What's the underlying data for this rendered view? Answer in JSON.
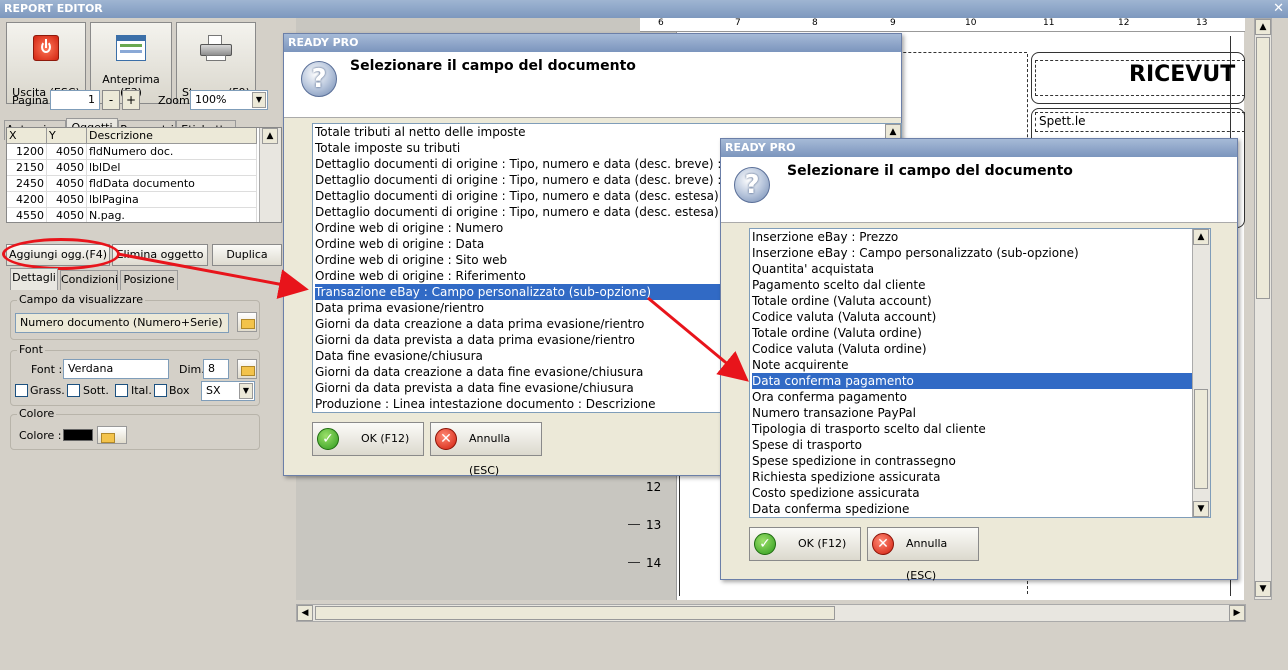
{
  "app": {
    "title": "REPORT EDITOR"
  },
  "toolbar": {
    "exit_label": "Uscita (ESC)",
    "preview_label": "Anteprima (F3)",
    "print_label": "Stampa (F9)",
    "page_label": "Pagina",
    "page_value": "1",
    "zoom_label": "Zoom",
    "zoom_value": "100%"
  },
  "tabs_top": [
    "Anteprima",
    "Oggetti",
    "Parametri",
    "Etichette"
  ],
  "objects_table": {
    "columns": [
      "X",
      "Y",
      "Descrizione"
    ],
    "rows": [
      {
        "x": "1200",
        "y": "4050",
        "desc": "fldNumero doc."
      },
      {
        "x": "2150",
        "y": "4050",
        "desc": "lblDel"
      },
      {
        "x": "2450",
        "y": "4050",
        "desc": "fldData documento"
      },
      {
        "x": "4200",
        "y": "4050",
        "desc": "lblPagina"
      },
      {
        "x": "4550",
        "y": "4050",
        "desc": "N.pag."
      }
    ]
  },
  "object_buttons": {
    "add": "Aggiungi ogg.(F4)",
    "delete": "Elimina oggetto",
    "duplicate": "Duplica"
  },
  "tabs_bottom": [
    "Dettagli",
    "Condizioni",
    "Posizione"
  ],
  "details": {
    "field_group_label": "Campo da visualizzare",
    "field_value": "Numero documento (Numero+Serie)",
    "font_group_label": "Font",
    "font_label": "Font :",
    "font_value": "Verdana",
    "dim_label": "Dim.",
    "dim_value": "8",
    "bold_label": "Grass.",
    "underline_label": "Sott.",
    "italic_label": "Ital.",
    "box_label": "Box",
    "align_value": "SX",
    "color_group_label": "Colore",
    "color_label": "Colore :",
    "color_value": "#000000"
  },
  "document_preview": {
    "ruler_marks": [
      "6",
      "7",
      "8",
      "9",
      "10",
      "11",
      "12",
      "13"
    ],
    "vruler_marks": [
      "12",
      "13",
      "14"
    ],
    "heading": "RICEVUT",
    "customer_label": "Spett.le"
  },
  "dialog1": {
    "title": "READY PRO",
    "heading": "Selezionare il campo del documento",
    "items": [
      "Totale tributi al netto delle imposte",
      "Totale imposte su tributi",
      "Dettaglio documenti di origine : Tipo, numero e data (desc. breve) : Ri",
      "Dettaglio documenti di origine : Tipo, numero e data (desc. breve) : In",
      "Dettaglio documenti di origine : Tipo, numero e data (desc. estesa) : R",
      "Dettaglio documenti di origine : Tipo, numero e data (desc. estesa) : In",
      "Ordine web di origine : Numero",
      "Ordine web di origine : Data",
      "Ordine web di origine : Sito web",
      "Ordine web di origine : Riferimento",
      "Transazione eBay : Campo personalizzato (sub-opzione)",
      "Data prima evasione/rientro",
      "Giorni da data creazione a data prima evasione/rientro",
      "Giorni da data prevista a data prima evasione/rientro",
      "Data fine evasione/chiusura",
      "Giorni da data creazione a data fine evasione/chiusura",
      "Giorni da data prevista a data fine evasione/chiusura",
      "Produzione : Linea intestazione documento : Descrizione"
    ],
    "selected_index": 10,
    "ok_label": "OK (F12)",
    "cancel_label": "Annulla (ESC)"
  },
  "dialog2": {
    "title": "READY PRO",
    "heading": "Selezionare il campo del documento",
    "items": [
      "Inserzione eBay : Prezzo",
      "Inserzione eBay : Campo personalizzato (sub-opzione)",
      "Quantita' acquistata",
      "Pagamento scelto dal cliente",
      "Totale ordine (Valuta account)",
      "Codice valuta (Valuta account)",
      "Totale ordine (Valuta ordine)",
      "Codice valuta (Valuta ordine)",
      "Note acquirente",
      "Data conferma pagamento",
      "Ora conferma pagamento",
      "Numero transazione PayPal",
      "Tipologia di trasporto scelto dal cliente",
      "Spese di trasporto",
      "Spese spedizione in contrassegno",
      "Richiesta spedizione assicurata",
      "Costo spedizione assicurata",
      "Data conferma spedizione"
    ],
    "selected_index": 9,
    "ok_label": "OK (F12)",
    "cancel_label": "Annulla (ESC)"
  },
  "colors": {
    "selection": "#316ac5",
    "annotation": "#e8141b",
    "titlebar": "#7d98be"
  }
}
